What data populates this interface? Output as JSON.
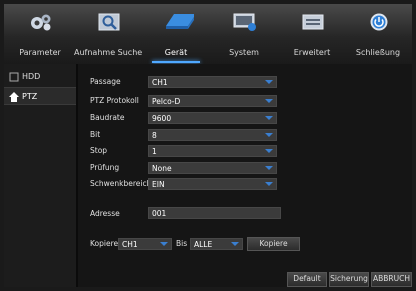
{
  "tabs": [
    {
      "label": "Parameter",
      "icon": "gears-icon"
    },
    {
      "label": "Aufnahme Suche",
      "icon": "search-icon"
    },
    {
      "label": "Gerät",
      "icon": "hdd-device-icon"
    },
    {
      "label": "System",
      "icon": "monitor-icon"
    },
    {
      "label": "Erweitert",
      "icon": "advanced-icon"
    },
    {
      "label": "Schließung",
      "icon": "power-icon"
    }
  ],
  "active_tab": "Gerät",
  "sidebar": {
    "items": [
      {
        "label": "HDD"
      },
      {
        "label": "PTZ"
      }
    ],
    "active": "PTZ"
  },
  "form": {
    "passage": {
      "label": "Passage",
      "value": "CH1"
    },
    "protokoll": {
      "label": "PTZ Protokoll",
      "value": "Pelco-D"
    },
    "baudrate": {
      "label": "Baudrate",
      "value": "9600"
    },
    "bit": {
      "label": "Bit",
      "value": "8"
    },
    "stop": {
      "label": "Stop",
      "value": "1"
    },
    "pruefung": {
      "label": "Prüfung",
      "value": "None"
    },
    "schwenk": {
      "label": "Schwenkbereich",
      "value": "EIN"
    },
    "adresse": {
      "label": "Adresse",
      "value": "001"
    }
  },
  "copy": {
    "label": "Kopiere",
    "from": "CH1",
    "bis_label": "Bis",
    "to": "ALLE",
    "button": "Kopiere"
  },
  "footer": {
    "default": "Default",
    "save": "Sicherung",
    "cancel": "ABBRUCH"
  },
  "colors": {
    "accent": "#4fa8ff",
    "arrow": "#3a7fd0"
  }
}
